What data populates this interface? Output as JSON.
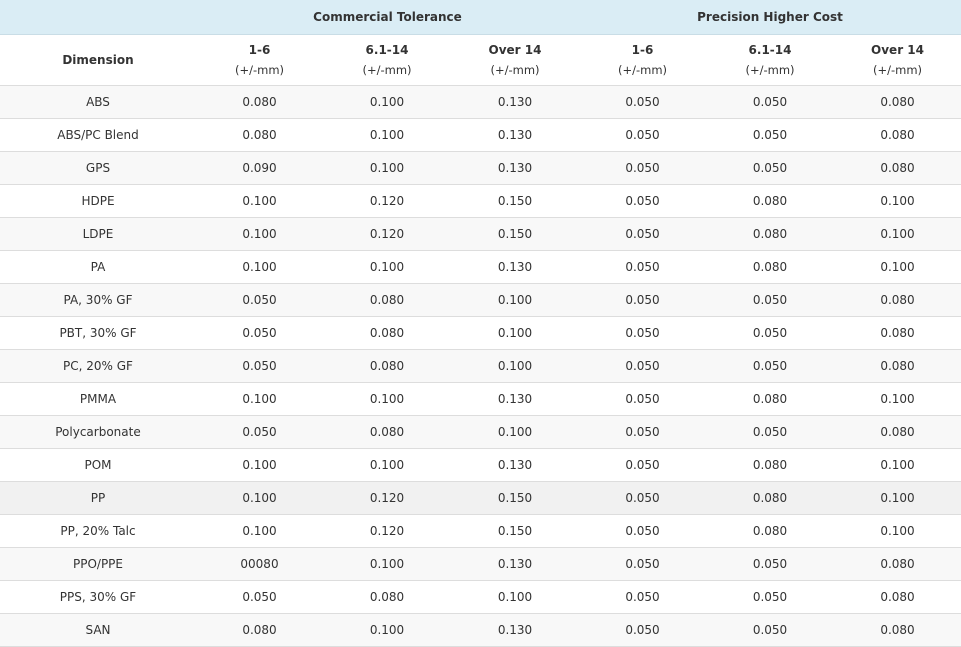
{
  "header": {
    "group_commercial": "Commercial Tolerance",
    "group_precision": "Precision Higher Cost",
    "dimension_label": "Dimension",
    "columns": [
      {
        "range": "1-6",
        "unit": "(+/-mm)"
      },
      {
        "range": "6.1-14",
        "unit": "(+/-mm)"
      },
      {
        "range": "Over 14",
        "unit": "(+/-mm)"
      },
      {
        "range": "1-6",
        "unit": "(+/-mm)"
      },
      {
        "range": "6.1-14",
        "unit": "(+/-mm)"
      },
      {
        "range": "Over 14",
        "unit": "(+/-mm)"
      }
    ]
  },
  "rows": [
    {
      "material": "ABS",
      "values": [
        "0.080",
        "0.100",
        "0.130",
        "0.050",
        "0.050",
        "0.080"
      ]
    },
    {
      "material": "ABS/PC Blend",
      "values": [
        "0.080",
        "0.100",
        "0.130",
        "0.050",
        "0.050",
        "0.080"
      ]
    },
    {
      "material": "GPS",
      "values": [
        "0.090",
        "0.100",
        "0.130",
        "0.050",
        "0.050",
        "0.080"
      ]
    },
    {
      "material": "HDPE",
      "values": [
        "0.100",
        "0.120",
        "0.150",
        "0.050",
        "0.080",
        "0.100"
      ]
    },
    {
      "material": "LDPE",
      "values": [
        "0.100",
        "0.120",
        "0.150",
        "0.050",
        "0.080",
        "0.100"
      ]
    },
    {
      "material": "PA",
      "values": [
        "0.100",
        "0.100",
        "0.130",
        "0.050",
        "0.080",
        "0.100"
      ]
    },
    {
      "material": "PA, 30% GF",
      "values": [
        "0.050",
        "0.080",
        "0.100",
        "0.050",
        "0.050",
        "0.080"
      ]
    },
    {
      "material": "PBT, 30% GF",
      "values": [
        "0.050",
        "0.080",
        "0.100",
        "0.050",
        "0.050",
        "0.080"
      ]
    },
    {
      "material": "PC, 20% GF",
      "values": [
        "0.050",
        "0.080",
        "0.100",
        "0.050",
        "0.050",
        "0.080"
      ]
    },
    {
      "material": "PMMA",
      "values": [
        "0.100",
        "0.100",
        "0.130",
        "0.050",
        "0.080",
        "0.100"
      ]
    },
    {
      "material": "Polycarbonate",
      "values": [
        "0.050",
        "0.080",
        "0.100",
        "0.050",
        "0.050",
        "0.080"
      ]
    },
    {
      "material": "POM",
      "values": [
        "0.100",
        "0.100",
        "0.130",
        "0.050",
        "0.080",
        "0.100"
      ]
    },
    {
      "material": "PP",
      "values": [
        "0.100",
        "0.120",
        "0.150",
        "0.050",
        "0.080",
        "0.100"
      ]
    },
    {
      "material": "PP, 20% Talc",
      "values": [
        "0.100",
        "0.120",
        "0.150",
        "0.050",
        "0.080",
        "0.100"
      ]
    },
    {
      "material": "PPO/PPE",
      "values": [
        "00080",
        "0.100",
        "0.130",
        "0.050",
        "0.050",
        "0.080"
      ]
    },
    {
      "material": "PPS, 30% GF",
      "values": [
        "0.050",
        "0.080",
        "0.100",
        "0.050",
        "0.050",
        "0.080"
      ]
    },
    {
      "material": "SAN",
      "values": [
        "0.080",
        "0.100",
        "0.130",
        "0.050",
        "0.050",
        "0.080"
      ]
    }
  ],
  "colors": {
    "group_header_bg": "#daedf5",
    "row_stripe": "#f8f8f8",
    "border": "#dddddd",
    "text": "#333333"
  }
}
